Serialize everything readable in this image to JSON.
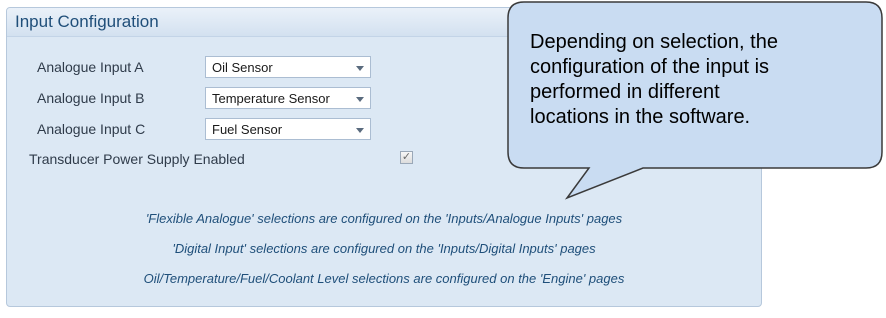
{
  "panel": {
    "title": "Input Configuration"
  },
  "inputs": [
    {
      "label": "Analogue Input A",
      "value": "Oil Sensor"
    },
    {
      "label": "Analogue Input B",
      "value": "Temperature Sensor"
    },
    {
      "label": "Analogue Input C",
      "value": "Fuel Sensor"
    }
  ],
  "transducer": {
    "label": "Transducer Power Supply Enabled",
    "checked": true,
    "check_glyph": "✓"
  },
  "notes": [
    "'Flexible Analogue' selections are configured on the 'Inputs/Analogue Inputs' pages",
    "'Digital Input' selections are configured on the 'Inputs/Digital Inputs' pages",
    "Oil/Temperature/Fuel/Coolant Level selections are configured on the 'Engine' pages"
  ],
  "callout": {
    "lines": [
      "Depending on selection, the",
      "configuration of the input is",
      "performed in different",
      "locations in the software."
    ]
  },
  "colors": {
    "panel_bg": "#dce8f4",
    "title": "#1f4e79",
    "note_text": "#1f4f7a",
    "callout_fill": "#c9dcf2"
  }
}
